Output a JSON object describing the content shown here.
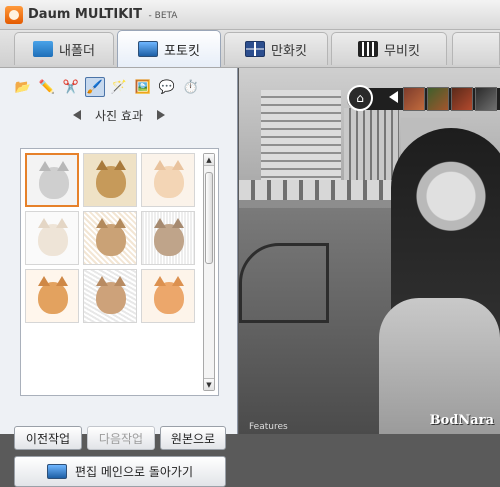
{
  "app": {
    "title": "Daum MULTIKIT",
    "beta": "- BETA"
  },
  "tabs": [
    {
      "label": "내폴더",
      "icon": "folder-icon",
      "active": false
    },
    {
      "label": "포토킷",
      "icon": "photo-icon",
      "active": true
    },
    {
      "label": "만화킷",
      "icon": "comic-icon",
      "active": false
    },
    {
      "label": "무비킷",
      "icon": "movie-clapper-icon",
      "active": false
    }
  ],
  "tools": [
    {
      "icon": "open-folder-icon",
      "selected": false
    },
    {
      "icon": "text-tool-icon",
      "selected": false
    },
    {
      "icon": "scissors-icon",
      "selected": false
    },
    {
      "icon": "photo-effect-icon",
      "selected": true
    },
    {
      "icon": "magic-wand-icon",
      "selected": false
    },
    {
      "icon": "frame-icon",
      "selected": false
    },
    {
      "icon": "speech-bubble-icon",
      "selected": false
    },
    {
      "icon": "timer-icon",
      "selected": false
    }
  ],
  "effect_nav": {
    "title": "사진 효과"
  },
  "buttons": {
    "previous": "이전작업",
    "next": "다음작업",
    "original": "원본으로",
    "back_to_main": "편집 메인으로 돌아가기"
  },
  "preview": {
    "watermark": "BodNara",
    "caption": "Features"
  },
  "colors": {
    "accent": "#e6812a",
    "panel_bg": "#eef1f5",
    "selected_tool": "#c7d9ee"
  }
}
